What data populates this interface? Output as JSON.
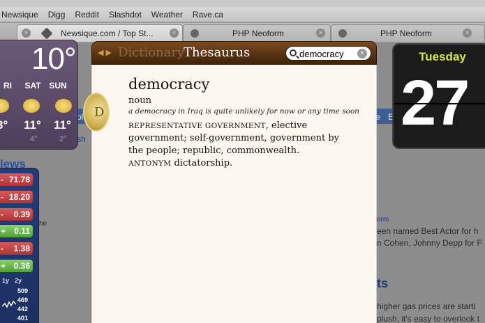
{
  "browser": {
    "bookmarks": [
      "Newsique",
      "Digg",
      "Reddit",
      "Slashdot",
      "Weather",
      "Rave.ca"
    ],
    "tabs": [
      {
        "label": "Newsique.com / Top St...",
        "active": true
      },
      {
        "label": "PHP Neoform",
        "active": false
      },
      {
        "label": "PHP Neoform",
        "active": false
      }
    ]
  },
  "background_page": {
    "snippets": [
      "he",
      "orm",
      "een named Best Actor for h",
      "n Cohen, Johnny Depp for F",
      "higher gas prices are starti",
      "plush, it's easy to overlook t",
      "ts",
      "olit",
      "e",
      "E",
      "sh",
      "lews"
    ]
  },
  "weather": {
    "temperature": "10°",
    "days": [
      "RI",
      "SAT",
      "SUN"
    ],
    "highs": [
      "3°",
      "11°",
      "11°"
    ],
    "lows": [
      "",
      "4°",
      "2°"
    ]
  },
  "stocks": {
    "changes": [
      {
        "sign": "-",
        "value": "71.78",
        "color": "red"
      },
      {
        "sign": "-",
        "value": "18.20",
        "color": "red"
      },
      {
        "sign": "-",
        "value": "0.39",
        "color": "red"
      },
      {
        "sign": "+",
        "value": "0.11",
        "color": "green"
      },
      {
        "sign": "-",
        "value": "1.38",
        "color": "red"
      },
      {
        "sign": "+",
        "value": "0.36",
        "color": "green"
      }
    ],
    "ranges": [
      "1y",
      "2y"
    ],
    "ticks": [
      "509",
      "469",
      "442",
      "401"
    ]
  },
  "calendar": {
    "day": "Tuesday",
    "date": "27"
  },
  "dictionary": {
    "tab_dictionary": "Dictionary",
    "tab_thesaurus": "Thesaurus",
    "search_value": "democracy",
    "badge_letter": "D",
    "headword": "democracy",
    "part_of_speech": "noun",
    "example": "a democracy in Iraq is quite unlikely for now or any time soon",
    "lead_term": "REPRESENTATIVE GOVERNMENT",
    "synonyms": ", elective government; self-government, government by the people; republic, commonwealth.",
    "antonym_label": "ANTONYM",
    "antonym": "dictatorship."
  },
  "colors": {
    "dictionary_bar": "#5a3312",
    "dictionary_page": "#fdf8ef",
    "calendar_day": "#d6e53a",
    "stock_red": "#b33333",
    "stock_green": "#4ea23a"
  }
}
